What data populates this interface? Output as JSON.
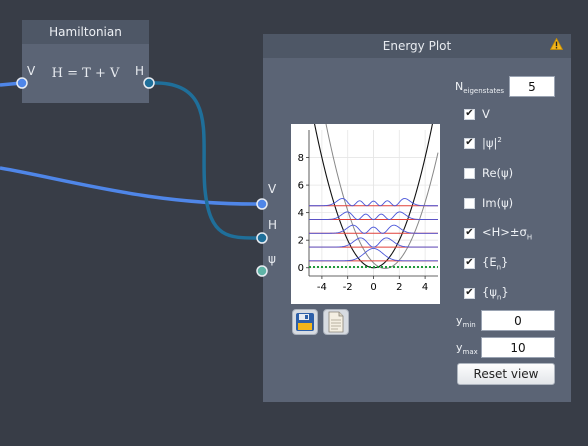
{
  "hamiltonian_node": {
    "title": "Hamiltonian",
    "input_label": "V",
    "output_label": "H",
    "formula": "H = T + V"
  },
  "energy_plot": {
    "title": "Energy Plot",
    "warning_icon": "warning-icon",
    "ports": {
      "v": "V",
      "h": "H",
      "psi": "ψ"
    },
    "eigenstates_label": "N",
    "eigenstates_label_sub": "eigenstates",
    "eigenstates_value": "5",
    "checkboxes": [
      {
        "label": "V",
        "checked": true
      },
      {
        "label": "|ψ|",
        "sup": "2",
        "checked": true
      },
      {
        "label": "Re(ψ)",
        "checked": false
      },
      {
        "label": "Im(ψ)",
        "checked": false
      },
      {
        "label": "<H>±σ",
        "sub": "H",
        "checked": true
      },
      {
        "label": "{E",
        "sub": "n",
        "suffix": "}",
        "checked": true
      },
      {
        "label": "{ψ",
        "sub": "n",
        "suffix": "}",
        "checked": true
      }
    ],
    "ymin_label": "y",
    "ymin_label_sub": "min",
    "ymin_value": "0",
    "ymax_label": "y",
    "ymax_label_sub": "max",
    "ymax_value": "10",
    "reset_label": "Reset view",
    "save_icon": "save-icon",
    "document_icon": "document-icon"
  },
  "chart_data": {
    "type": "line",
    "xlim": [
      -5,
      5
    ],
    "ylim": [
      -0.6,
      10
    ],
    "x_ticks": [
      -4,
      -2,
      0,
      2,
      4
    ],
    "y_ticks": [
      0,
      2,
      4,
      6,
      8
    ],
    "grid": true,
    "potential": "parabola",
    "energy_levels": [
      0.5,
      1.5,
      2.5,
      3.5,
      4.5
    ],
    "colors": {
      "potential": "#111111",
      "energy_levels": "#e0403a",
      "wavefunctions": "#4a56d9",
      "expectation": "#1f9a3a",
      "shifted_potential": "#888888"
    }
  }
}
